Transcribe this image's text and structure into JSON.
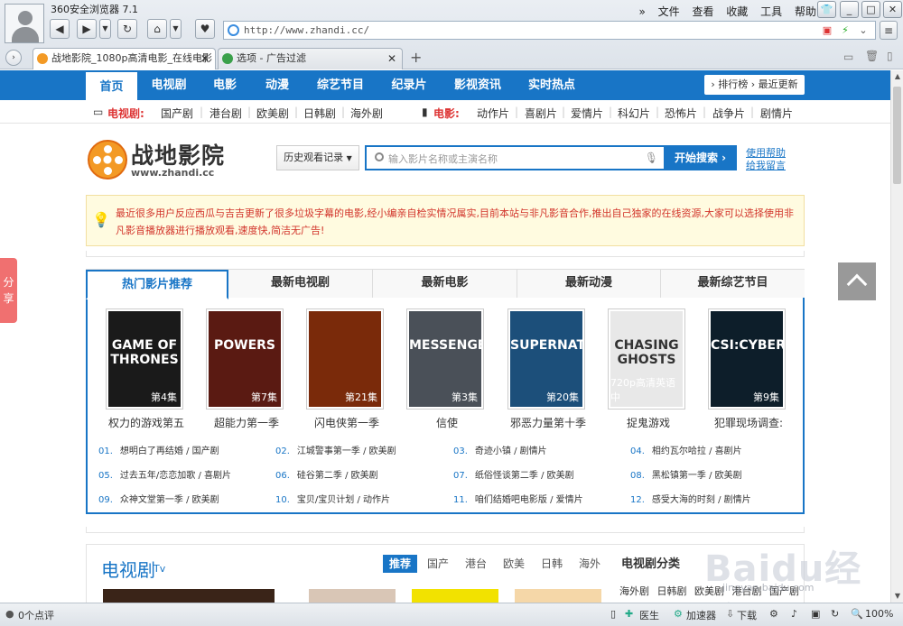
{
  "browser": {
    "app_name": "360安全浏览器 7.1",
    "menu": [
      "文件",
      "查看",
      "收藏",
      "工具",
      "帮助"
    ],
    "url": "http://www.zhandi.cc/",
    "tabs": [
      {
        "title": "战地影院_1080p高清电影_在线电影",
        "active": true
      },
      {
        "title": "选项 - 广告过滤",
        "active": false
      }
    ]
  },
  "topnav": {
    "items": [
      "首页",
      "电视剧",
      "电影",
      "动漫",
      "综艺节目",
      "纪录片",
      "影视资讯",
      "实时热点"
    ],
    "right": "› 排行榜  › 最近更新"
  },
  "subnav": {
    "tv_label": "电视剧:",
    "tv_items": [
      "国产剧",
      "港台剧",
      "欧美剧",
      "日韩剧",
      "海外剧"
    ],
    "movie_label": "电影:",
    "movie_items": [
      "动作片",
      "喜剧片",
      "爱情片",
      "科幻片",
      "恐怖片",
      "战争片",
      "剧情片"
    ]
  },
  "logo": {
    "text": "战地影院",
    "url": "www.zhandi.cc"
  },
  "search": {
    "history_label": "历史观看记录",
    "placeholder": "输入影片名称或主演名称",
    "button": "开始搜索 ›",
    "help": "使用帮助",
    "feedback": "给我留言"
  },
  "notice": "最近很多用户反应西瓜与吉吉更新了很多垃圾字幕的电影,经小编亲自检实情况属实,目前本站与非凡影音合作,推出自己独家的在线资源,大家可以选择使用非凡影音播放器进行播放观看,速度快,简洁无广告!",
  "hot": {
    "tabs": [
      "热门影片推荐",
      "最新电视剧",
      "最新电影",
      "最新动漫",
      "最新综艺节目"
    ],
    "posters": [
      {
        "title": "权力的游戏第五",
        "episode": "第4集",
        "poster_text": "GAME OF THRONES",
        "color": "#1a1a1a"
      },
      {
        "title": "超能力第一季",
        "episode": "第7集",
        "poster_text": "POWERS",
        "color": "#5a1a12"
      },
      {
        "title": "闪电侠第一季",
        "episode": "第21集",
        "poster_text": "",
        "color": "#7a2a0a"
      },
      {
        "title": "信使",
        "episode": "第3集",
        "poster_text": "MESSENGERS",
        "color": "#4a5058"
      },
      {
        "title": "邪恶力量第十季",
        "episode": "第20集",
        "poster_text": "SUPERNATURAL",
        "color": "#1c4f7a"
      },
      {
        "title": "捉鬼游戏",
        "episode": "720p高清英语中",
        "poster_text": "CHASING GHOSTS",
        "color": "#e8e8e8"
      },
      {
        "title": "犯罪现场调查:",
        "episode": "第9集",
        "poster_text": "CSI:CYBER",
        "color": "#0d1e2a"
      }
    ],
    "list": [
      {
        "n": "01.",
        "t": "想明白了再结婚 / 国产剧"
      },
      {
        "n": "02.",
        "t": "江城警事第一季 / 欧美剧"
      },
      {
        "n": "03.",
        "t": "奇迹小镇 / 剧情片"
      },
      {
        "n": "04.",
        "t": "相约瓦尔哈拉 / 喜剧片"
      },
      {
        "n": "05.",
        "t": "过去五年/恋恋加歌 / 喜剧片"
      },
      {
        "n": "06.",
        "t": "硅谷第二季 / 欧美剧"
      },
      {
        "n": "07.",
        "t": "纸俗怪谈第二季 / 欧美剧"
      },
      {
        "n": "08.",
        "t": "黑松镇第一季 / 欧美剧"
      },
      {
        "n": "09.",
        "t": "众神文堂第一季 / 欧美剧"
      },
      {
        "n": "10.",
        "t": "宝贝/宝贝计划 / 动作片"
      },
      {
        "n": "11.",
        "t": "咱们结婚吧电影版 / 爱情片"
      },
      {
        "n": "12.",
        "t": "感受大海的时刻 / 剧情片"
      }
    ]
  },
  "tv": {
    "title": "电视剧",
    "sub": "Tv",
    "tabs": [
      "推荐",
      "国产",
      "港台",
      "欧美",
      "日韩",
      "海外"
    ],
    "category_title": "电视剧分类",
    "categories": [
      "海外剧",
      "日韩剧",
      "欧美剧",
      "港台剧",
      "国产剧"
    ]
  },
  "share": "分享",
  "watermark": {
    "text": "Baidu经验",
    "url": "jingyan.baidu.com"
  },
  "status": {
    "comments": "0个点评",
    "doctor": "医生",
    "accelerator": "加速器",
    "download": "下载",
    "zoom": "100%"
  }
}
